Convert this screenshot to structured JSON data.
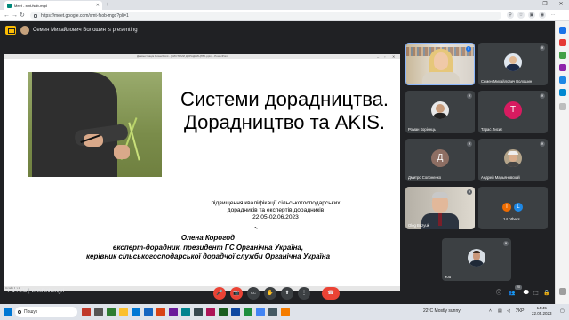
{
  "browser": {
    "tab_title": "Meet - xmt-fsob-mgd",
    "tab_close": "✕",
    "url": "https://meet.google.com/xmt-fsob-mgd?pli=1"
  },
  "meet": {
    "presenting_text": "Семен Михайлович Волошин is presenting",
    "meeting_time": "2:45 PM",
    "meeting_code": "xmt-fsob-mgd",
    "participant_count": "20"
  },
  "slide": {
    "window_title": "Демонстрація PowerPoint - [СИСТЕМИ ДОРАДНИЦТВА.pptx] - PowerPoint",
    "footer_text": "Слайд 1 з 1",
    "title": "Системи дорадництва. Дорадництво та AKIS.",
    "subtitle_line1": "підвищення кваліфікації сільськогосподарських",
    "subtitle_line2": "дорадників та експертів дорадників",
    "subtitle_line3": "22.05-02.06.2023",
    "author_name": "Олена Корогод",
    "author_line2": "експерт-дорадник, президент ГС Органічна Україна,",
    "author_line3": "керівник сільськогосподарської дорадчої служби  Органічна Україна"
  },
  "participants": [
    {
      "name": "",
      "type": "video"
    },
    {
      "name": "Семен Михайлович Волошин",
      "type": "photo"
    },
    {
      "name": "Роман Коріннць",
      "type": "photo"
    },
    {
      "name": "Тарас Лисиє",
      "initial": "T",
      "color": "#d81b60"
    },
    {
      "name": "Дмитро Солоненко",
      "initial": "Д",
      "color": "#8d6e63"
    },
    {
      "name": "Андрей Марьяновский",
      "type": "photo"
    },
    {
      "name": "Oleg Bezyuk",
      "type": "video"
    },
    {
      "name": "14 others",
      "initials": [
        "I",
        "L"
      ],
      "colors": [
        "#ef6c00",
        "#1e88e5"
      ]
    },
    {
      "name": "You",
      "type": "photo"
    }
  ],
  "taskbar": {
    "search_placeholder": "Пошук",
    "weather": "22°C  Mostly sunny",
    "language": "УКР",
    "time": "14:45",
    "date": "22.05.2023"
  },
  "icons": {
    "mic": "🎤",
    "camera": "📷",
    "captions": "CC",
    "raise_hand": "✋",
    "present": "⬆",
    "more": "⋮",
    "hangup": "☎",
    "info": "ⓘ",
    "people": "👥",
    "chat": "💬",
    "activities": "⬚",
    "host": "🔒"
  }
}
